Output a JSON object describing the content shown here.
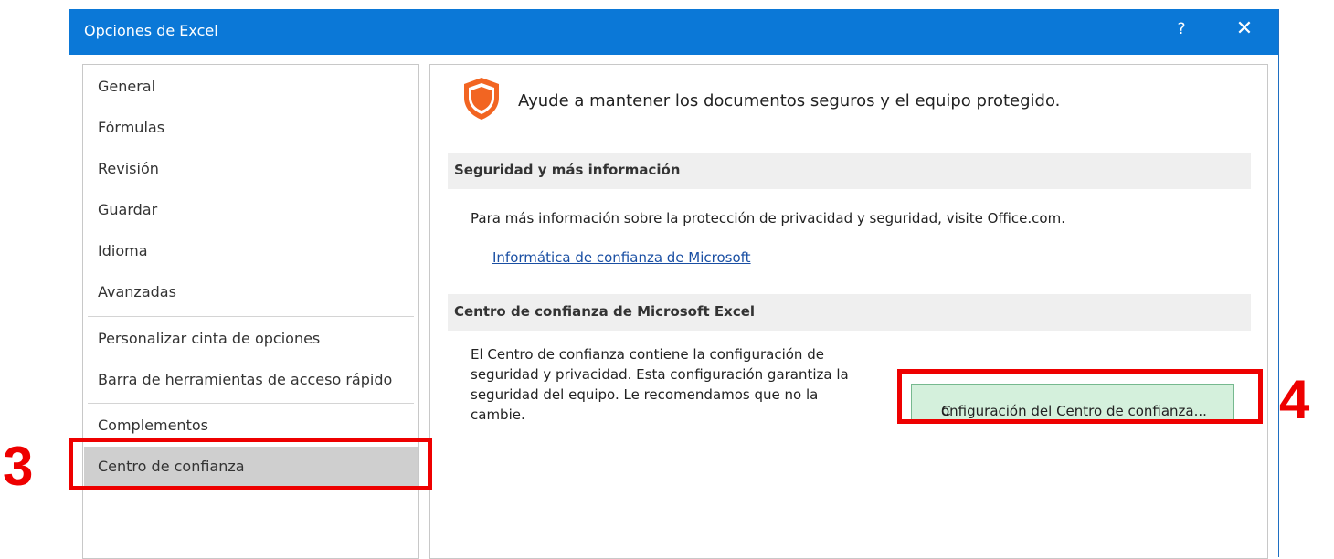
{
  "window": {
    "title": "Opciones de Excel",
    "help_label": "?",
    "close_label": "✕"
  },
  "nav": {
    "items": [
      {
        "label": "General"
      },
      {
        "label": "Fórmulas"
      },
      {
        "label": "Revisión"
      },
      {
        "label": "Guardar"
      },
      {
        "label": "Idioma"
      },
      {
        "label": "Avanzadas"
      },
      {
        "label": "Personalizar cinta de opciones"
      },
      {
        "label": "Barra de herramientas de acceso rápido"
      },
      {
        "label": "Complementos"
      },
      {
        "label": "Centro de confianza",
        "selected": true
      }
    ]
  },
  "content": {
    "headline": "Ayude a mantener los documentos seguros y el equipo protegido.",
    "section1": {
      "title": "Seguridad y más información",
      "text": "Para más información sobre la protección de privacidad y seguridad, visite Office.com.",
      "link": "Informática de confianza de Microsoft"
    },
    "section2": {
      "title": "Centro de confianza de Microsoft Excel",
      "text_lines": [
        "El Centro de confianza contiene la configuración de",
        "seguridad y privacidad. Esta configuración garantiza la",
        "seguridad del equipo. Le recomendamos que no la",
        "cambie."
      ],
      "button_accel": "C",
      "button_rest": "onfiguración del Centro de confianza..."
    }
  },
  "annotations": {
    "step3": "3",
    "step4": "4"
  },
  "colors": {
    "titlebar": "#0b78d7",
    "selected_nav": "#cfcfcf",
    "annotation_red": "#ee0000",
    "button_green": "#d4f0dc",
    "shield_orange": "#f26522"
  }
}
